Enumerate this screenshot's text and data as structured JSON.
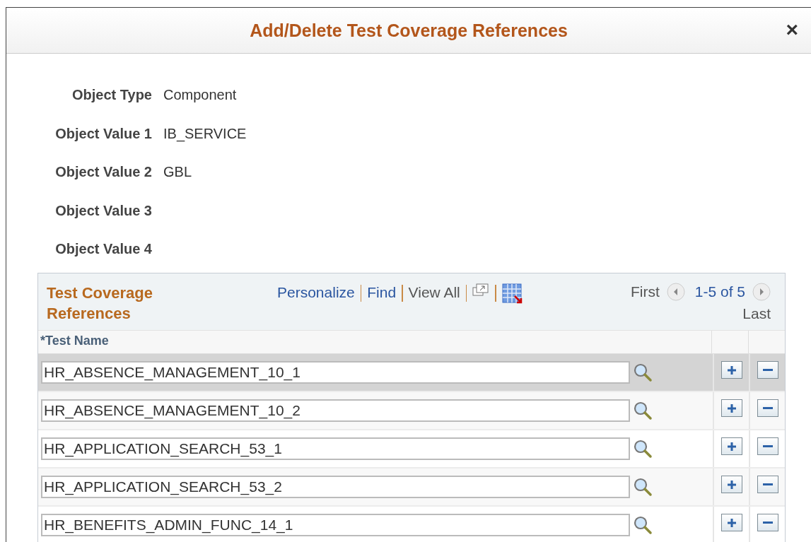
{
  "dialog": {
    "title": "Add/Delete Test Coverage References",
    "close": "×"
  },
  "fields": [
    {
      "label": "Object Type",
      "value": "Component"
    },
    {
      "label": "Object Value 1",
      "value": "IB_SERVICE"
    },
    {
      "label": "Object Value 2",
      "value": "GBL"
    },
    {
      "label": "Object Value 3"
    },
    {
      "label": "Object Value 4"
    }
  ],
  "grid": {
    "title": "Test Coverage References",
    "links": [
      "Personalize",
      "Find",
      "View All"
    ],
    "first": "First",
    "range": "1-5 of 5",
    "last": "Last",
    "column_header": "*Test Name",
    "rows": [
      {
        "test_name": "HR_ABSENCE_MANAGEMENT_10_1",
        "selected": true
      },
      {
        "test_name": "HR_ABSENCE_MANAGEMENT_10_2",
        "selected": false
      },
      {
        "test_name": "HR_APPLICATION_SEARCH_53_1",
        "selected": false
      },
      {
        "test_name": "HR_APPLICATION_SEARCH_53_2",
        "selected": false
      },
      {
        "test_name": "HR_BENEFITS_ADMIN_FUNC_14_1",
        "selected": false
      }
    ]
  }
}
